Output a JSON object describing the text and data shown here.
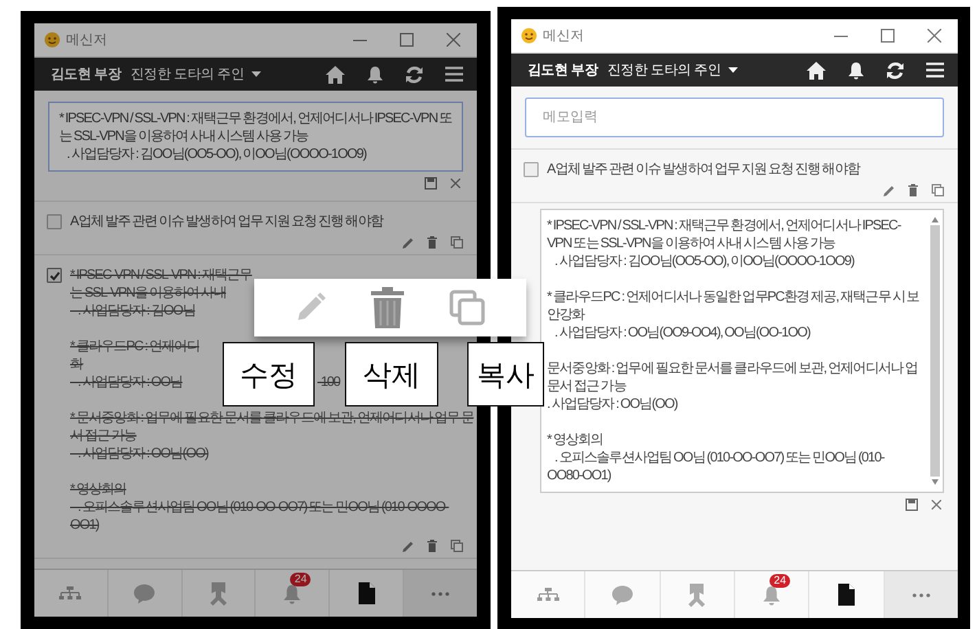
{
  "panels": [
    {
      "dimmed": true,
      "window": {
        "title": "메신저"
      },
      "toolbar": {
        "user": "김도현 부장",
        "status": "진정한 도타의 주인"
      },
      "sections": [
        {
          "kind": "editor",
          "blocks": [
            [
              "* IPSEC-VPN / SSL-VPN : 재택근무 환경에서, 언제어디서나 IPSEC-VPN 또",
              "는 SSL-VPN을 이용하여 사내 시스템 사용 가능",
              "    . 사업담당자 : 김OO님(OO5-OO), 이OO님(OOOO-1OO9)"
            ]
          ]
        },
        {
          "kind": "memo",
          "checked": false,
          "blocks": [
            [
              "A업체 발주 관련 이슈 발생하여 업무 지원 요청 진행 해야함"
            ]
          ]
        },
        {
          "kind": "memo",
          "checked": true,
          "blocks": [
            [
              "* IPSEC-VPN / SSL-VPN : 재택근무",
              "는 SSL-VPN을 이용하여 사내",
              "    . 사업담당자 : 김OO님"
            ],
            [
              "* 클라우드PC : 언제어디",
              "화",
              [
                "    . 사업담당자 : OO님",
                "-100"
              ]
            ],
            [
              "* 문서중앙화 : 업무에 필요한 문서를 클라우드에 보관, 언제어디서나 업무 문",
              "서 접근 가능",
              "    . 사업담당자 : OO님(OO)"
            ],
            [
              "* 영상회의",
              "    . 오피스솔루션사업팀 OO님 (010-OO-OO7) 또는 민OO님 (010-OOOO-",
              "OO1)"
            ]
          ]
        }
      ],
      "nav": [
        {
          "selected": false
        },
        {
          "selected": false
        },
        {
          "selected": false
        },
        {
          "selected": false,
          "badge": "24"
        },
        {
          "selected": true
        },
        {
          "selected": false
        }
      ]
    },
    {
      "dimmed": false,
      "window": {
        "title": "메신저"
      },
      "toolbar": {
        "user": "김도현 부장",
        "status": "진정한 도타의 주인"
      },
      "sections": [
        {
          "kind": "input",
          "placeholder": "메모입력"
        },
        {
          "kind": "memo",
          "checked": false,
          "blocks": [
            [
              "A업체 발주 관련 이슈 발생하여 업무 지원 요청 진행 해야함"
            ]
          ]
        },
        {
          "kind": "editor",
          "blocks": [
            [
              "* IPSEC-VPN / SSL-VPN : 재택근무 환경에서, 언제어디서나 IPSEC-",
              "VPN 또는 SSL-VPN을 이용하여 사내 시스템 사용 가능",
              "    . 사업담당자 : 김OO님(OO5-OO), 이OO님(OOOO-1OO9)"
            ],
            [
              "* 클라우드PC : 언제어디서나 동일한 업무PC환경 제공, 재택근무 시 보",
              "안강화",
              "    . 사업담당자 : OO님(OO9-OO4), OO님(OO-1OO)"
            ],
            [
              "문서중앙화 : 업무에 필요한 문서를 클라우드에 보관, 언제어디서나 업",
              "문서 접근 가능",
              ". 사업담당자 : OO님(OO)"
            ],
            [
              "* 영상회의",
              "    . 오피스솔루션사업팀 OO님 (010-OO-OO7) 또는 민OO님 (010-",
              "OO80-OO1)"
            ]
          ]
        }
      ],
      "nav": [
        {
          "selected": false
        },
        {
          "selected": false
        },
        {
          "selected": false
        },
        {
          "selected": false,
          "badge": "24"
        },
        {
          "selected": true
        },
        {
          "selected": false
        }
      ]
    }
  ],
  "callout": {
    "labels": [
      "수정",
      "삭제",
      "복사"
    ]
  }
}
